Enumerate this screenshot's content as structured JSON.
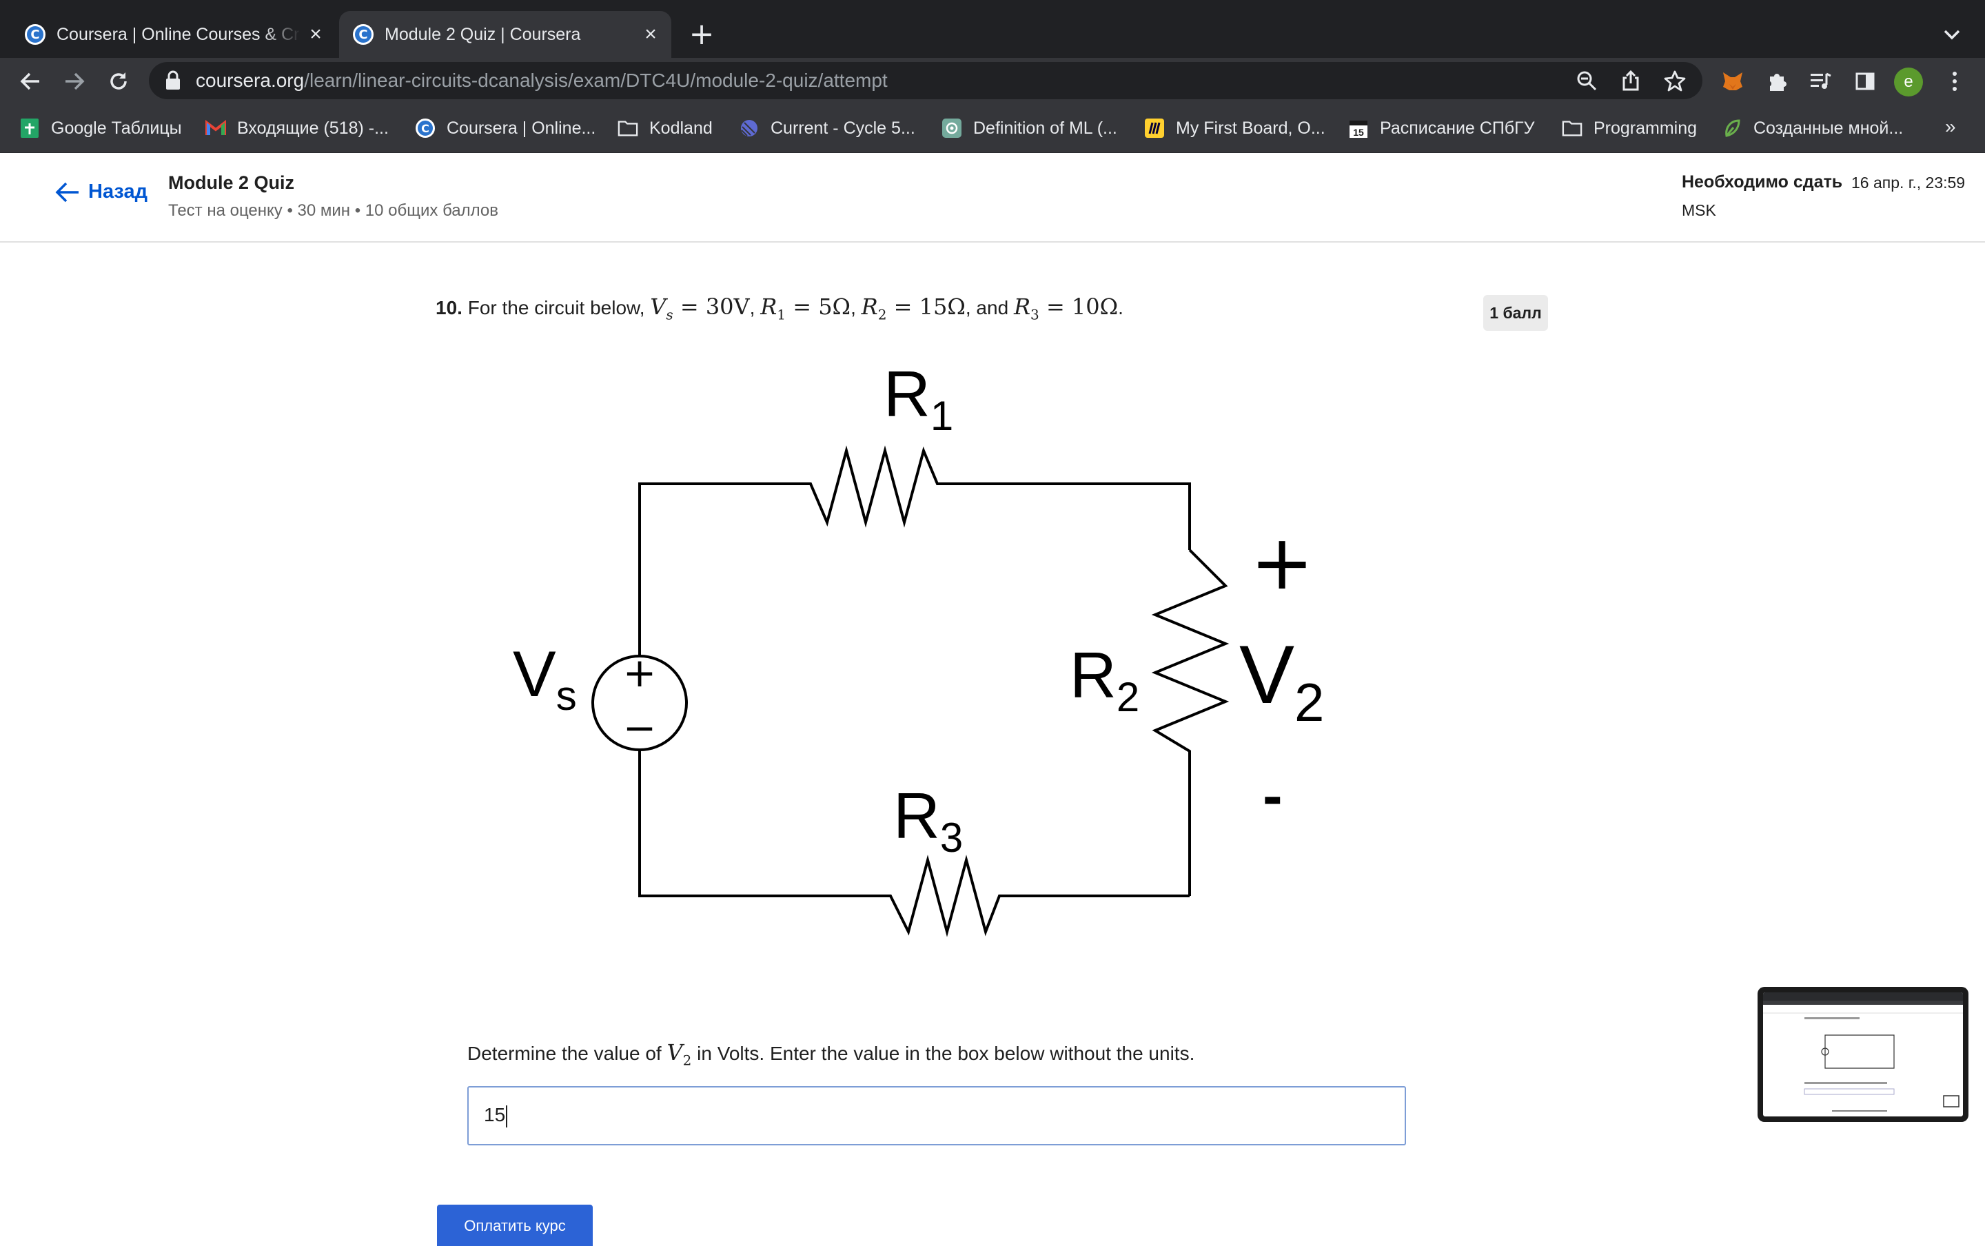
{
  "browser": {
    "tabs": [
      {
        "title": "Coursera | Online Courses & Cr",
        "active": false
      },
      {
        "title": "Module 2 Quiz | Coursera",
        "active": true
      }
    ],
    "url_host": "coursera.org",
    "url_path": "/learn/linear-circuits-dcanalysis/exam/DTC4U/module-2-quiz/attempt",
    "profile_initial": "e",
    "bookmarks": [
      {
        "label": "Google Таблицы",
        "icon": "sheets-icon"
      },
      {
        "label": "Входящие (518) -...",
        "icon": "gmail-icon"
      },
      {
        "label": "Coursera | Online...",
        "icon": "coursera-icon"
      },
      {
        "label": "Kodland",
        "icon": "folder-icon"
      },
      {
        "label": "Current - Cycle 5...",
        "icon": "linear-icon"
      },
      {
        "label": "Definition of ML (...",
        "icon": "openai-icon"
      },
      {
        "label": "My First Board, O...",
        "icon": "miro-icon"
      },
      {
        "label": "Расписание СПбГУ",
        "icon": "calendar-icon"
      },
      {
        "label": "Programming",
        "icon": "folder-icon"
      },
      {
        "label": "Созданные мной...",
        "icon": "leaf-icon"
      }
    ],
    "bookmarks_more": "»",
    "calendar_day": "15"
  },
  "header": {
    "back_label": "Назад",
    "quiz_title": "Module 2 Quiz",
    "quiz_meta": "Тест на оценку • 30 мин • 10 общих баллов",
    "due_label": "Необходимо сдать",
    "due_date": "16 апр. г., 23:59",
    "due_tz": "MSK"
  },
  "question": {
    "number": "10.",
    "intro": "For the circuit below,",
    "sep_and": ", and",
    "period": ".",
    "given": [
      {
        "sym": "V",
        "sub": "s",
        "val": "30V"
      },
      {
        "sym": "R",
        "sub": "1",
        "val": "5Ω"
      },
      {
        "sym": "R",
        "sub": "2",
        "val": "15Ω"
      },
      {
        "sym": "R",
        "sub": "3",
        "val": "10Ω"
      }
    ],
    "points": "1 балл",
    "prompt_before": "Determine the value of",
    "prompt_var": "V",
    "prompt_sub": "2",
    "prompt_after": "in Volts. Enter the value in the box below without the units.",
    "answer_value": "15"
  },
  "circuit": {
    "labels": {
      "r1": "R",
      "r1_sub": "1",
      "r2": "R",
      "r2_sub": "2",
      "r3": "R",
      "r3_sub": "3",
      "vs": "V",
      "vs_sub": "s",
      "v2": "V",
      "v2_sub": "2",
      "plus": "+",
      "minus": "-",
      "src_plus": "+",
      "src_minus": "−"
    }
  },
  "footer": {
    "pay_button": "Оплатить курс"
  },
  "colors": {
    "link_blue": "#0056d2",
    "button_blue": "#2c63d6",
    "chrome_dark": "#202124",
    "chrome_toolbar": "#35363a"
  }
}
